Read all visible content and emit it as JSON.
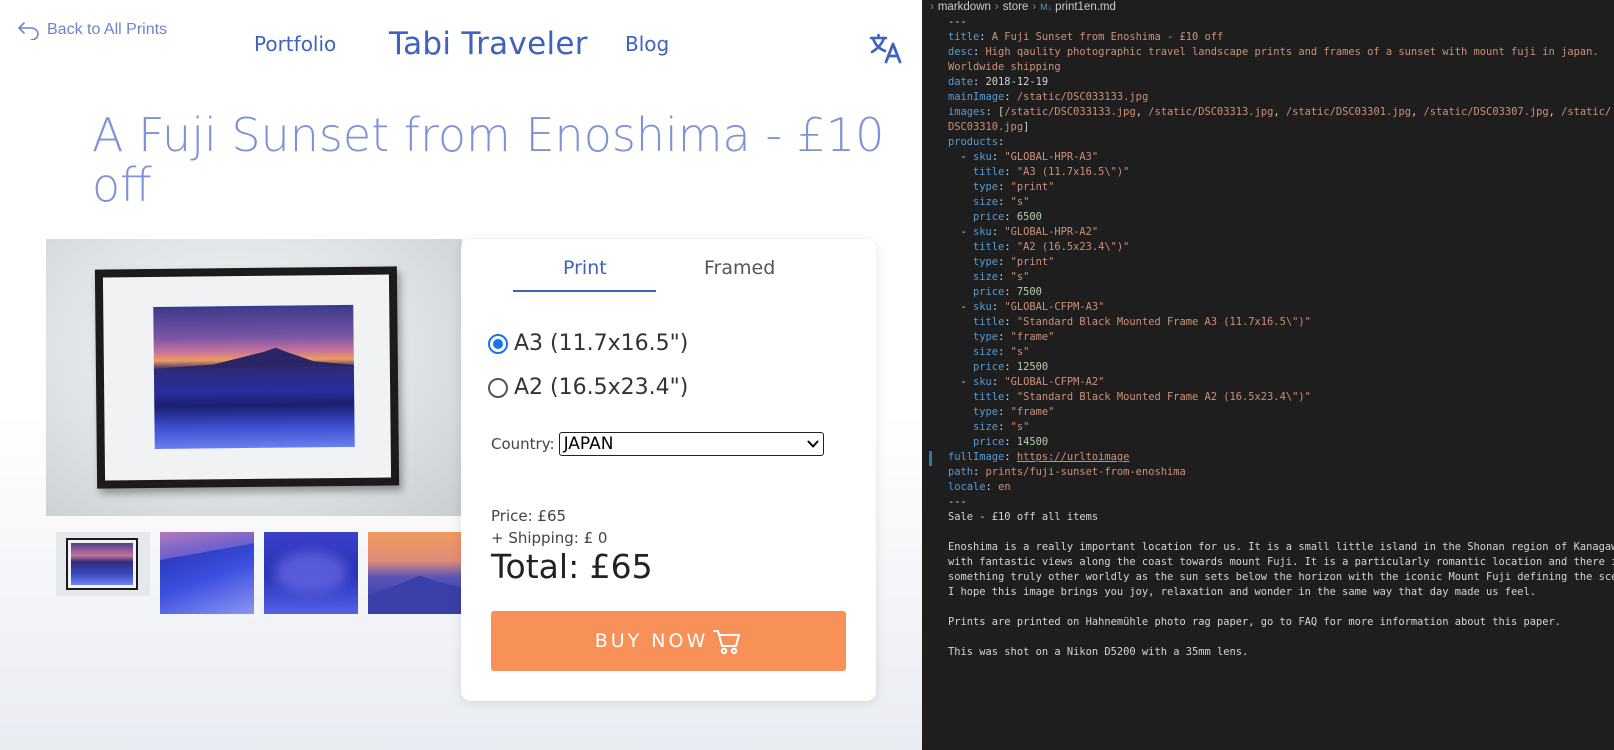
{
  "site": {
    "back_link": "Back to All Prints",
    "nav": {
      "portfolio": "Portfolio",
      "title": "Tabi Traveler",
      "blog": "Blog"
    },
    "page_title": "A Fuji Sunset from Enoshima - £10 off",
    "tabs": [
      "Print",
      "Framed"
    ],
    "active_tab": "Print",
    "sizes": [
      {
        "label": "A3 (11.7x16.5\")",
        "selected": true
      },
      {
        "label": "A2 (16.5x23.4\")",
        "selected": false
      }
    ],
    "country_label": "Country:",
    "country_value": "JAPAN",
    "price": "Price: £65",
    "shipping": "+ Shipping: £ 0",
    "total": "Total: £65",
    "buy_label": "BUY NOW",
    "colors": {
      "accent": "#3f62c0",
      "title": "#7e93d5",
      "buy": "#f89158"
    }
  },
  "editor": {
    "breadcrumb": [
      "markdown",
      "store",
      "print1en.md"
    ],
    "lines": [
      [
        [
          "p",
          "---"
        ]
      ],
      [
        [
          "k",
          "title"
        ],
        [
          "p",
          ": "
        ],
        [
          "s",
          "A Fuji Sunset from Enoshima - £10 off"
        ]
      ],
      [
        [
          "k",
          "desc"
        ],
        [
          "p",
          ": "
        ],
        [
          "s",
          "High qaulity photographic travel landscape prints and frames of a sunset with mount fuji in japan."
        ]
      ],
      [
        [
          "s",
          "Worldwide shipping"
        ]
      ],
      [
        [
          "k",
          "date"
        ],
        [
          "p",
          ": 2018-12-19"
        ]
      ],
      [
        [
          "k",
          "mainImage"
        ],
        [
          "p",
          ": "
        ],
        [
          "s",
          "/static/DSC033133.jpg"
        ]
      ],
      [
        [
          "k",
          "images"
        ],
        [
          "p",
          ": ["
        ],
        [
          "s",
          "/static/DSC033133.jpg"
        ],
        [
          "p",
          ", "
        ],
        [
          "s",
          "/static/DSC03313.jpg"
        ],
        [
          "p",
          ", "
        ],
        [
          "s",
          "/static/DSC03301.jpg"
        ],
        [
          "p",
          ", "
        ],
        [
          "s",
          "/static/DSC03307.jpg"
        ],
        [
          "p",
          ", "
        ],
        [
          "s",
          "/static/"
        ]
      ],
      [
        [
          "s",
          "DSC03310.jpg"
        ],
        [
          "p",
          "]"
        ]
      ],
      [
        [
          "k",
          "products"
        ],
        [
          "p",
          ":"
        ]
      ],
      [
        [
          "p",
          "  - "
        ],
        [
          "k",
          "sku"
        ],
        [
          "p",
          ": "
        ],
        [
          "s",
          "\"GLOBAL-HPR-A3\""
        ]
      ],
      [
        [
          "p",
          "    "
        ],
        [
          "k",
          "title"
        ],
        [
          "p",
          ": "
        ],
        [
          "s",
          "\"A3 (11.7x16.5\\\")\""
        ]
      ],
      [
        [
          "p",
          "    "
        ],
        [
          "k",
          "type"
        ],
        [
          "p",
          ": "
        ],
        [
          "s",
          "\"print\""
        ]
      ],
      [
        [
          "p",
          "    "
        ],
        [
          "k",
          "size"
        ],
        [
          "p",
          ": "
        ],
        [
          "s",
          "\"s\""
        ]
      ],
      [
        [
          "p",
          "    "
        ],
        [
          "k",
          "price"
        ],
        [
          "p",
          ": "
        ],
        [
          "n",
          "6500"
        ]
      ],
      [
        [
          "p",
          "  - "
        ],
        [
          "k",
          "sku"
        ],
        [
          "p",
          ": "
        ],
        [
          "s",
          "\"GLOBAL-HPR-A2\""
        ]
      ],
      [
        [
          "p",
          "    "
        ],
        [
          "k",
          "title"
        ],
        [
          "p",
          ": "
        ],
        [
          "s",
          "\"A2 (16.5x23.4\\\")\""
        ]
      ],
      [
        [
          "p",
          "    "
        ],
        [
          "k",
          "type"
        ],
        [
          "p",
          ": "
        ],
        [
          "s",
          "\"print\""
        ]
      ],
      [
        [
          "p",
          "    "
        ],
        [
          "k",
          "size"
        ],
        [
          "p",
          ": "
        ],
        [
          "s",
          "\"s\""
        ]
      ],
      [
        [
          "p",
          "    "
        ],
        [
          "k",
          "price"
        ],
        [
          "p",
          ": "
        ],
        [
          "n",
          "7500"
        ]
      ],
      [
        [
          "p",
          "  - "
        ],
        [
          "k",
          "sku"
        ],
        [
          "p",
          ": "
        ],
        [
          "s",
          "\"GLOBAL-CFPM-A3\""
        ]
      ],
      [
        [
          "p",
          "    "
        ],
        [
          "k",
          "title"
        ],
        [
          "p",
          ": "
        ],
        [
          "s",
          "\"Standard Black Mounted Frame A3 (11.7x16.5\\\")\""
        ]
      ],
      [
        [
          "p",
          "    "
        ],
        [
          "k",
          "type"
        ],
        [
          "p",
          ": "
        ],
        [
          "s",
          "\"frame\""
        ]
      ],
      [
        [
          "p",
          "    "
        ],
        [
          "k",
          "size"
        ],
        [
          "p",
          ": "
        ],
        [
          "s",
          "\"s\""
        ]
      ],
      [
        [
          "p",
          "    "
        ],
        [
          "k",
          "price"
        ],
        [
          "p",
          ": "
        ],
        [
          "n",
          "12500"
        ]
      ],
      [
        [
          "p",
          "  - "
        ],
        [
          "k",
          "sku"
        ],
        [
          "p",
          ": "
        ],
        [
          "s",
          "\"GLOBAL-CFPM-A2\""
        ]
      ],
      [
        [
          "p",
          "    "
        ],
        [
          "k",
          "title"
        ],
        [
          "p",
          ": "
        ],
        [
          "s",
          "\"Standard Black Mounted Frame A2 (16.5x23.4\\\")\""
        ]
      ],
      [
        [
          "p",
          "    "
        ],
        [
          "k",
          "type"
        ],
        [
          "p",
          ": "
        ],
        [
          "s",
          "\"frame\""
        ]
      ],
      [
        [
          "p",
          "    "
        ],
        [
          "k",
          "size"
        ],
        [
          "p",
          ": "
        ],
        [
          "s",
          "\"s\""
        ]
      ],
      [
        [
          "p",
          "    "
        ],
        [
          "k",
          "price"
        ],
        [
          "p",
          ": "
        ],
        [
          "n",
          "14500"
        ]
      ],
      [
        [
          "k",
          "fullImage"
        ],
        [
          "p",
          ": "
        ],
        [
          "u",
          "https://urltoimage"
        ]
      ],
      [
        [
          "k",
          "path"
        ],
        [
          "p",
          ": "
        ],
        [
          "s",
          "prints/fuji-sunset-from-enoshima"
        ]
      ],
      [
        [
          "k",
          "locale"
        ],
        [
          "p",
          ": "
        ],
        [
          "s",
          "en"
        ]
      ],
      [
        [
          "p",
          "---"
        ]
      ],
      [
        [
          "p",
          "Sale - £10 off all items"
        ]
      ],
      [
        [
          "p",
          ""
        ]
      ],
      [
        [
          "p",
          "Enoshima is a really important location for us. It is a small little island in the Shonan region of Kanagawa"
        ]
      ],
      [
        [
          "p",
          "with fantastic views along the coast towards mount Fuji. It is a particularly romantic location and there is"
        ]
      ],
      [
        [
          "p",
          "something truly other worldly as the sun sets below the horizon with the iconic Mount Fuji defining the scene."
        ]
      ],
      [
        [
          "p",
          "I hope this image brings you joy, relaxation and wonder in the same way that day made us feel."
        ]
      ],
      [
        [
          "p",
          ""
        ]
      ],
      [
        [
          "p",
          "Prints are printed on Hahnemühle photo rag paper, go to FAQ for more information about this paper."
        ]
      ],
      [
        [
          "p",
          ""
        ]
      ],
      [
        [
          "p",
          "This was shot on a Nikon D5200 with a 35mm lens."
        ]
      ]
    ]
  }
}
